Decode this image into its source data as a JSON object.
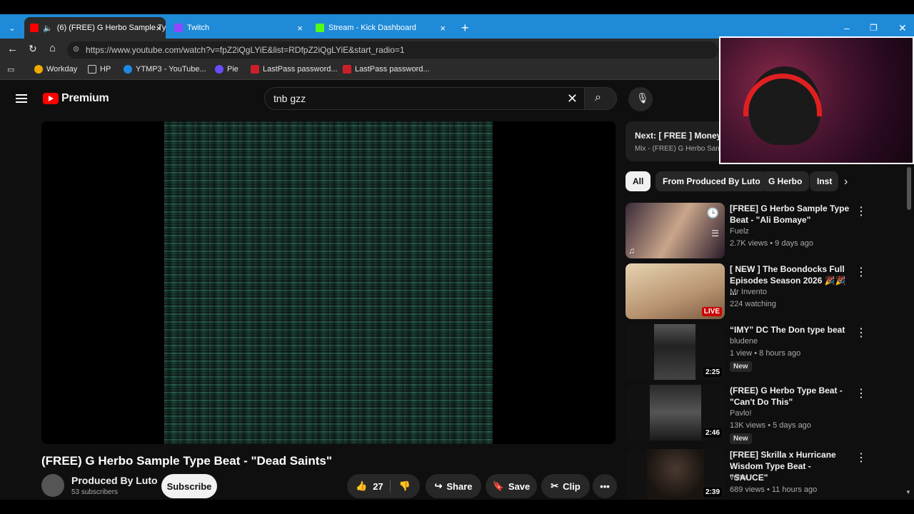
{
  "browser": {
    "tabs": [
      {
        "label": "(6) (FREE) G Herbo Sample Ty",
        "active": true,
        "color": "#ff0000"
      },
      {
        "label": "Twitch",
        "active": false,
        "color": "#9146ff"
      },
      {
        "label": "Stream - Kick Dashboard",
        "active": false,
        "color": "#53fc18"
      }
    ],
    "url": "https://www.youtube.com/watch?v=fpZ2iQgLYiE&list=RDfpZ2iQgLYiE&start_radio=1",
    "bookmarks": [
      "Workday",
      "HP",
      "YTMP3 - YouTube...",
      "Pie",
      "LastPass password...",
      "LastPass password..."
    ]
  },
  "yt": {
    "logo": "Premium",
    "search_query": "tnb gzz",
    "video_title": "(FREE) G Herbo Sample Type Beat - \"Dead Saints\"",
    "channel_name": "Produced By Luto",
    "subscribers": "53 subscribers",
    "subscribe_label": "Subscribe",
    "likes": "27",
    "share_label": "Share",
    "save_label": "Save",
    "clip_label": "Clip",
    "next_label": "Next: [ FREE ] Money M",
    "next_sub": "Mix - (FREE) G Herbo Sam",
    "chips": [
      "All",
      "From Produced By Luto",
      "G Herbo",
      "Inst"
    ],
    "recs": [
      {
        "title": "[FREE] G Herbo Sample Type Beat - \"Ali Bomaye\"",
        "channel": "Fuelz",
        "meta": "2.7K views • 9 days ago",
        "duration": "",
        "badge": ""
      },
      {
        "title": "[ NEW ] The Boondocks Full Episodes Season 2026 🎉🎉 ...",
        "channel": "Mr Invento",
        "meta": "224 watching",
        "duration": "LIVE",
        "badge": ""
      },
      {
        "title": "“IMY” DC The Don type beat",
        "channel": "bludene",
        "meta": "1 view • 8 hours ago",
        "duration": "2:25",
        "badge": "New"
      },
      {
        "title": "(FREE) G Herbo Type Beat - \"Can't Do This\"",
        "channel": "Pavlo!",
        "meta": "13K views • 5 days ago",
        "duration": "2:46",
        "badge": "New"
      },
      {
        "title": "[FREE] Skrilla x Hurricane Wisdom Type Beat - \"SAUCE\"",
        "channel": "volto",
        "meta": "689 views • 11 hours ago",
        "duration": "2:39",
        "badge": ""
      }
    ]
  }
}
